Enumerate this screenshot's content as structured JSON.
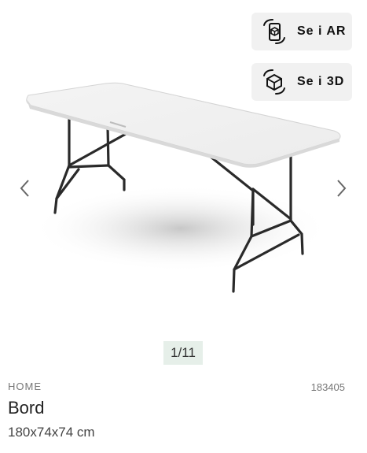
{
  "ar_button": {
    "label": "Se i AR",
    "icon": "ar-cube-phone-icon"
  },
  "view3d_button": {
    "label": "Se i 3D",
    "icon": "cube-3d-icon"
  },
  "gallery": {
    "prev_icon": "chevron-left-icon",
    "next_icon": "chevron-right-icon",
    "pager": "1/11"
  },
  "product": {
    "brand": "HOME",
    "sku": "183405",
    "title": "Bord",
    "dimensions": "180x74x74 cm"
  },
  "colors": {
    "pager_bg": "#e6efe9",
    "button_bg": "#f1f1f1"
  }
}
